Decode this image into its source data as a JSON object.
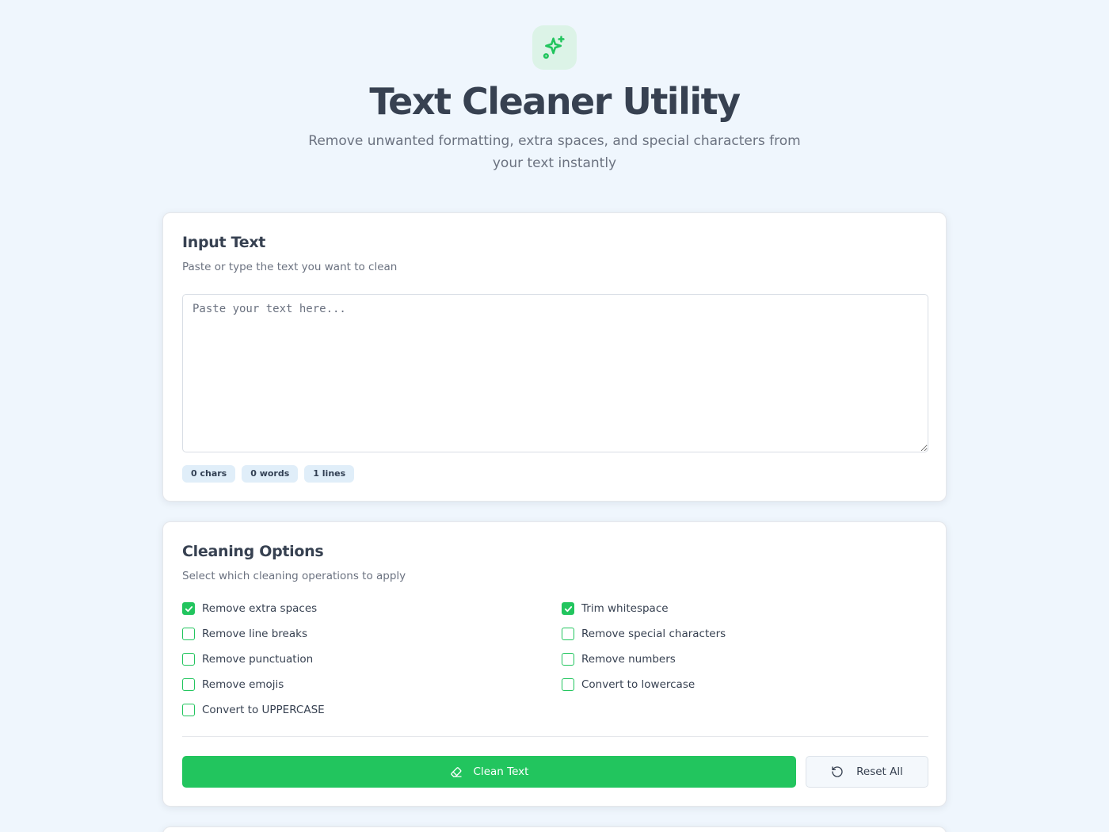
{
  "header": {
    "icon": "sparkles-icon",
    "title": "Text Cleaner Utility",
    "subtitle": "Remove unwanted formatting, extra spaces, and special characters from your text instantly"
  },
  "input_card": {
    "title": "Input Text",
    "description": "Paste or type the text you want to clean",
    "textarea_value": "",
    "textarea_placeholder": "Paste your text here...",
    "stats": {
      "chars": "0 chars",
      "words": "0 words",
      "lines": "1 lines"
    }
  },
  "options_card": {
    "title": "Cleaning Options",
    "description": "Select which cleaning operations to apply",
    "options": [
      {
        "label": "Remove extra spaces",
        "checked": true
      },
      {
        "label": "Trim whitespace",
        "checked": true
      },
      {
        "label": "Remove line breaks",
        "checked": false
      },
      {
        "label": "Remove special characters",
        "checked": false
      },
      {
        "label": "Remove punctuation",
        "checked": false
      },
      {
        "label": "Remove numbers",
        "checked": false
      },
      {
        "label": "Remove emojis",
        "checked": false
      },
      {
        "label": "Convert to lowercase",
        "checked": false
      },
      {
        "label": "Convert to UPPERCASE",
        "checked": false
      }
    ],
    "clean_button": {
      "label": "Clean Text",
      "icon": "eraser-icon"
    },
    "reset_button": {
      "label": "Reset All",
      "icon": "rotate-ccw-icon"
    }
  },
  "colors": {
    "accent": "#22c55e",
    "background": "#eff6fd",
    "badge_bg": "#e0eef9",
    "title_text": "#374151",
    "muted_text": "#6b7280"
  }
}
